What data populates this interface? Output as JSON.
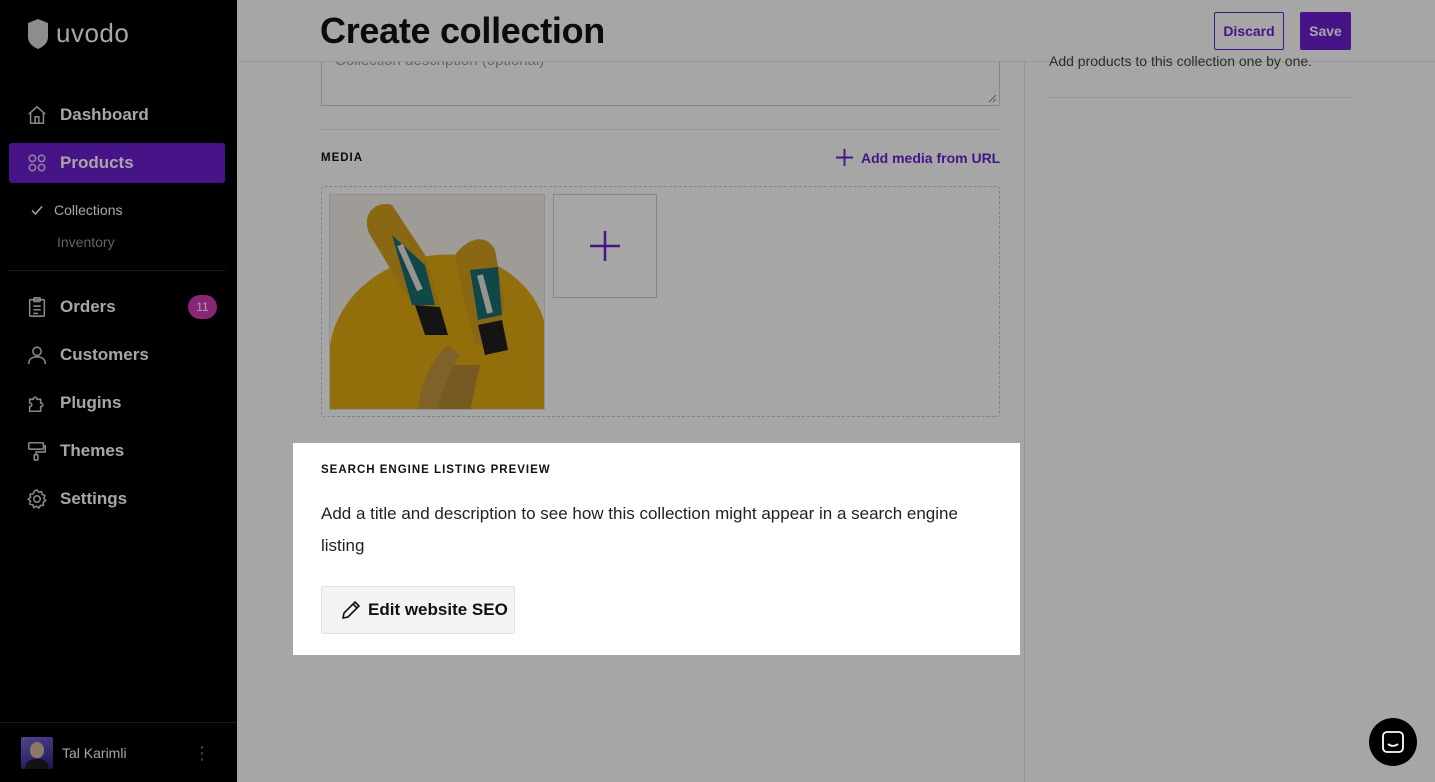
{
  "brand": {
    "name": "uvodo",
    "accent": "#6d1fd1",
    "badge_color": "#d33bb5"
  },
  "sidebar": {
    "items": [
      {
        "label": "Dashboard",
        "icon": "home-icon"
      },
      {
        "label": "Products",
        "icon": "grid-icon",
        "active": true
      },
      {
        "label": "Orders",
        "icon": "clipboard-icon",
        "badge": "11"
      },
      {
        "label": "Customers",
        "icon": "user-icon"
      },
      {
        "label": "Plugins",
        "icon": "puzzle-icon"
      },
      {
        "label": "Themes",
        "icon": "paint-roller-icon"
      },
      {
        "label": "Settings",
        "icon": "gear-icon"
      }
    ],
    "subitems": [
      {
        "label": "Collections",
        "active": true,
        "icon": "check-icon"
      },
      {
        "label": "Inventory"
      }
    ],
    "user": {
      "name": "Tal Karimli",
      "menu": "⋮"
    }
  },
  "header": {
    "title": "Create collection",
    "discard_label": "Discard",
    "save_label": "Save"
  },
  "form": {
    "description_placeholder": "Collection description (optional)",
    "media_label": "MEDIA",
    "add_media_label": "Add media from URL",
    "side_help": "Add products to this collection one by one."
  },
  "seo": {
    "title": "SEARCH ENGINE LISTING PREVIEW",
    "description": "Add a title and description to see how this collection might appear in a search engine listing",
    "button_label": "Edit website SEO"
  }
}
